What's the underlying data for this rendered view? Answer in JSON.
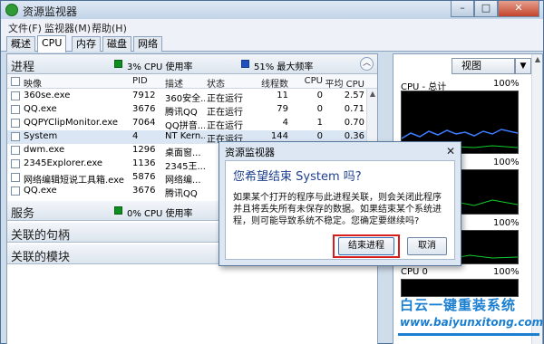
{
  "window": {
    "title": "资源监视器",
    "controls": {
      "minimize": "–",
      "maximize": "□",
      "close": "✕"
    }
  },
  "menu": [
    "文件(F)",
    "监视器(M)",
    "帮助(H)"
  ],
  "tabs": [
    "概述",
    "CPU",
    "内存",
    "磁盘",
    "网络"
  ],
  "active_tab": "CPU",
  "process_section": {
    "title": "进程",
    "cpu_usage": "3% CPU 使用率",
    "max_freq": "51% 最大频率",
    "columns": {
      "image": "映像",
      "pid": "PID",
      "desc": "描述",
      "status": "状态",
      "threads": "线程数",
      "cpu": "CPU",
      "avg_cpu": "平均 CPU"
    },
    "rows": [
      {
        "image": "360se.exe",
        "pid": "7912",
        "desc": "360安全...",
        "status": "正在运行",
        "threads": "11",
        "cpu": "0",
        "avg_cpu": "2.57"
      },
      {
        "image": "QQ.exe",
        "pid": "3676",
        "desc": "腾讯QQ",
        "status": "正在运行",
        "threads": "79",
        "cpu": "0",
        "avg_cpu": "0.71"
      },
      {
        "image": "QQPYClipMonitor.exe",
        "pid": "7064",
        "desc": "QQ拼音...",
        "status": "正在运行",
        "threads": "4",
        "cpu": "1",
        "avg_cpu": "0.70"
      },
      {
        "image": "System",
        "pid": "4",
        "desc": "NT Kern...",
        "status": "正在运行",
        "threads": "144",
        "cpu": "0",
        "avg_cpu": "0.36"
      },
      {
        "image": "dwm.exe",
        "pid": "1296",
        "desc": "桌面窗...",
        "status": "",
        "threads": "",
        "cpu": "",
        "avg_cpu": ""
      },
      {
        "image": "2345Explorer.exe",
        "pid": "1136",
        "desc": "2345王...",
        "status": "",
        "threads": "",
        "cpu": "",
        "avg_cpu": ""
      },
      {
        "image": "网络编辑短说工具箱.exe",
        "pid": "5876",
        "desc": "网络编...",
        "status": "",
        "threads": "",
        "cpu": "",
        "avg_cpu": ""
      },
      {
        "image": "QQ.exe",
        "pid": "3676",
        "desc": "腾讯QQ",
        "status": "",
        "threads": "",
        "cpu": "",
        "avg_cpu": ""
      }
    ]
  },
  "services_section": {
    "title": "服务",
    "cpu_usage": "0% CPU 使用率"
  },
  "handles_section": {
    "title": "关联的句柄"
  },
  "modules_section": {
    "title": "关联的模块"
  },
  "right_panel": {
    "view_button": "视图",
    "view_dropdown": "▼",
    "graphs": [
      {
        "left_label": "CPU - 总计",
        "right_label": "100%"
      },
      {
        "left_label": "",
        "right_label": "100%"
      },
      {
        "left_label": "",
        "right_label": "100%"
      },
      {
        "left_label": "CPU 0",
        "right_label": "100%"
      }
    ]
  },
  "dialog": {
    "title": "资源监视器",
    "close": "✕",
    "heading": "您希望结束 System 吗?",
    "message": "如果某个打开的程序与此进程关联，则会关闭此程序并且将丢失所有未保存的数据。如果结束某个系统进程，则可能导致系统不稳定。您确定要继续吗?",
    "confirm": "结束进程",
    "cancel": "取消"
  },
  "watermark": {
    "title": "白云一键重装系统",
    "url": "www.baiyunxitong.com"
  },
  "colors": {
    "green": "#0c8f1e",
    "blue": "#1f4fbf",
    "accent": "#1d3f8f",
    "highlight": "#d81d1d"
  }
}
